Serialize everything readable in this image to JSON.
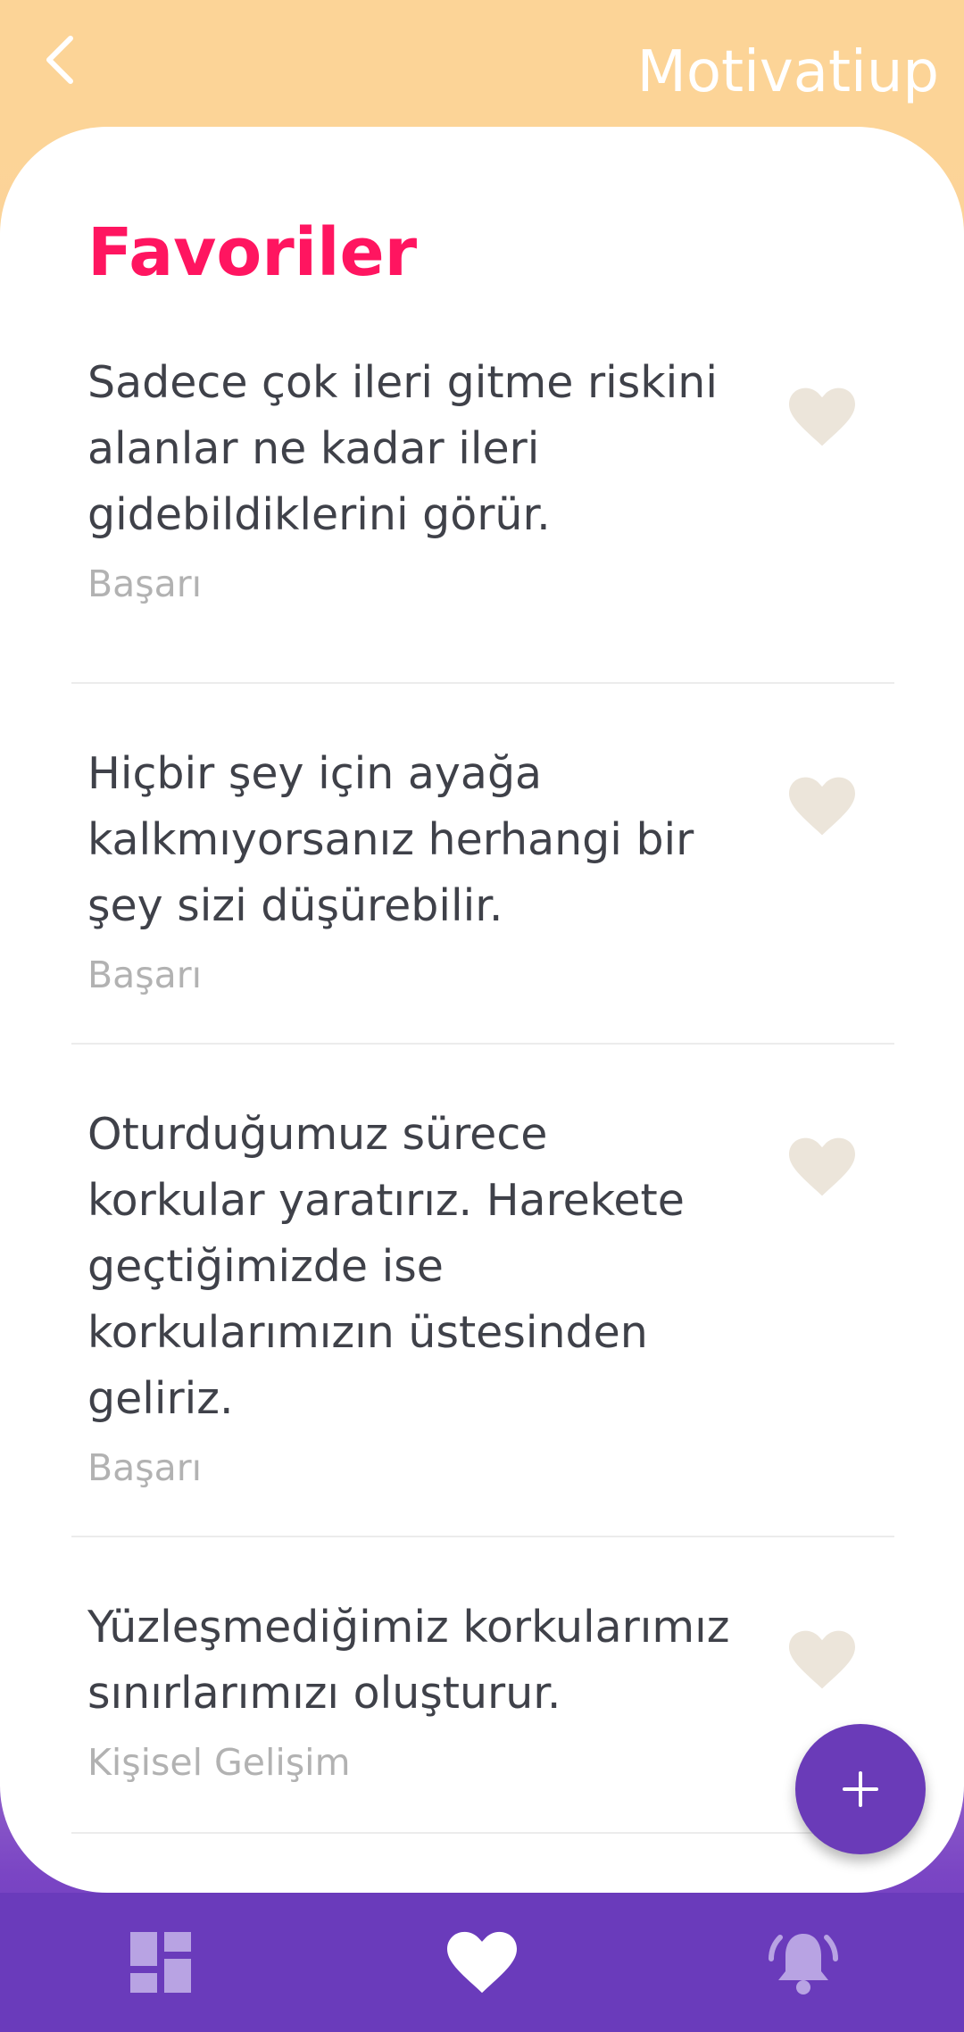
{
  "header": {
    "back_icon": "chevron-left-icon",
    "app_title": "Motivatiup"
  },
  "section_title": "Favoriler",
  "quotes": [
    {
      "text": "Sadece çok ileri gitme riskini alanlar ne kadar ileri gidebildiklerini görür.",
      "category": "Başarı"
    },
    {
      "text": "Hiçbir şey için ayağa kalkmıyorsanız herhangi bir şey sizi düşürebilir.",
      "category": "Başarı"
    },
    {
      "text": "Oturduğumuz sürece korkular yaratırız. Harekete geçtiğimizde ise korkularımızın üstesinden geliriz.",
      "category": "Başarı"
    },
    {
      "text": "Yüzleşmediğimiz korkularımız sınırlarımızı oluşturur.",
      "category": "Kişisel Gelişim"
    }
  ],
  "fab": {
    "icon": "plus-icon"
  },
  "bottom_nav": [
    {
      "icon": "dashboard-icon",
      "active": false
    },
    {
      "icon": "heart-icon",
      "active": true
    },
    {
      "icon": "bell-icon",
      "active": false
    }
  ],
  "colors": {
    "header_bg": "#fcd497",
    "accent_pink": "#ff1560",
    "nav_purple": "#6a3bb8",
    "heart_beige": "#ece5da"
  }
}
